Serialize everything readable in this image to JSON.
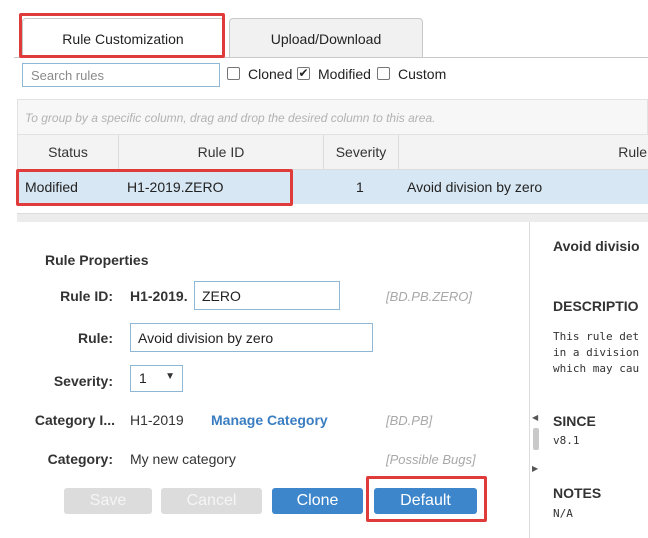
{
  "tabs": [
    {
      "label": "Rule Customization",
      "active": true
    },
    {
      "label": "Upload/Download",
      "active": false
    }
  ],
  "filter": {
    "search_placeholder": "Search rules",
    "checkboxes": [
      {
        "label": "Cloned",
        "checked": false
      },
      {
        "label": "Modified",
        "checked": true
      },
      {
        "label": "Custom",
        "checked": false
      }
    ],
    "check_glyph": "✔"
  },
  "grid": {
    "group_hint": "To group by a specific column, drag and drop the desired column to this area.",
    "columns": [
      "Status",
      "Rule ID",
      "Severity",
      "Rule"
    ],
    "rows": [
      {
        "status": "Modified",
        "rule_id": "H1-2019.ZERO",
        "severity": "1",
        "rule": "Avoid division by zero"
      }
    ]
  },
  "properties": {
    "title": "Rule Properties",
    "rule_id_label": "Rule ID:",
    "rule_id_prefix": "H1-2019.",
    "rule_id_value": "ZERO",
    "rule_id_code": "[BD.PB.ZERO]",
    "rule_label": "Rule:",
    "rule_value": "Avoid division by zero",
    "severity_label": "Severity:",
    "severity_value": "1",
    "category_id_label": "Category I...",
    "category_id_value": "H1-2019",
    "manage_category": "Manage Category",
    "category_id_code": "[BD.PB]",
    "category_label": "Category:",
    "category_value": "My new category",
    "category_code": "[Possible Bugs]"
  },
  "buttons": {
    "save": "Save",
    "cancel": "Cancel",
    "clone": "Clone",
    "default": "Default"
  },
  "doc": {
    "title": "Avoid divisio",
    "description_head": "DESCRIPTIO",
    "description_lines": [
      "This rule det",
      "in a division",
      "which may cau"
    ],
    "since_head": "SINCE",
    "since_value": "v8.1",
    "notes_head": "NOTES",
    "notes_value": "N/A"
  },
  "colors": {
    "highlight": "#e03b3b",
    "selected_row": "#d7e7f3",
    "primary_button": "#3d86cc",
    "link": "#3a7dc1"
  }
}
